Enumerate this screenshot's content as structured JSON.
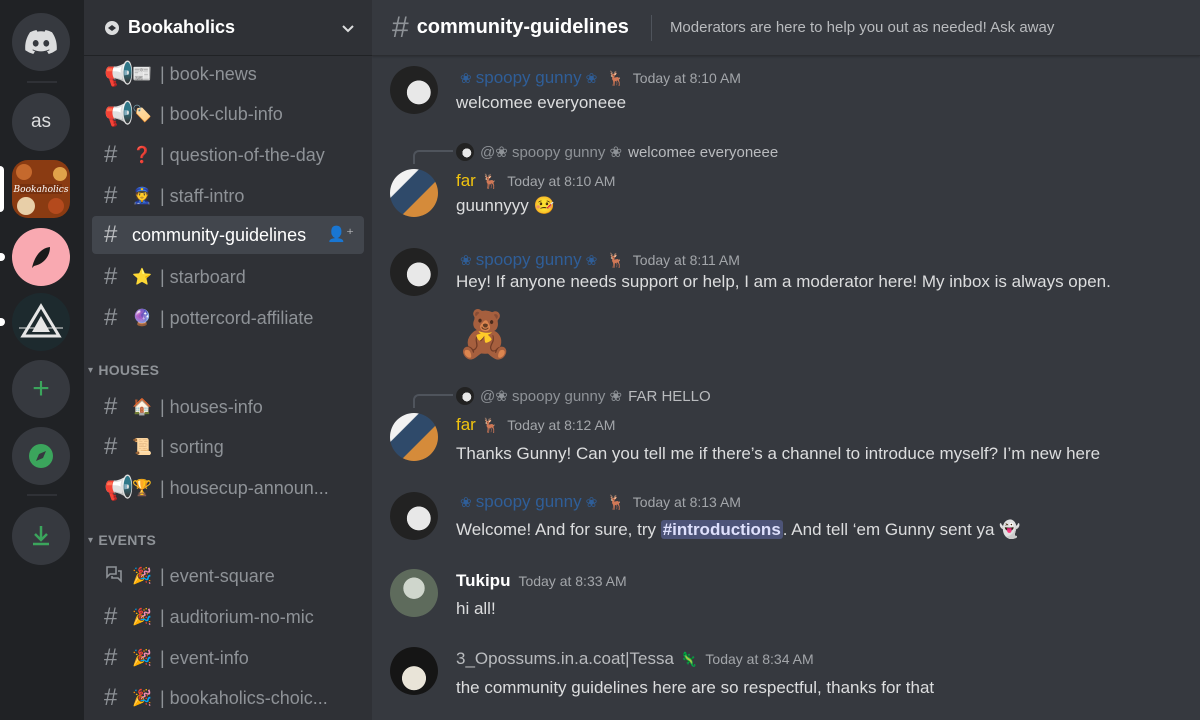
{
  "rail": {
    "home_icon": "discord-logo-icon",
    "servers": [
      {
        "label": "as"
      },
      {
        "label": "Bookaholics",
        "selected": true
      },
      {
        "label": ""
      },
      {
        "label": ""
      }
    ],
    "add_icon": "plus-icon",
    "explore_icon": "compass-icon",
    "download_icon": "download-icon",
    "add_glyph": "+",
    "accent_green": "#3ba55c"
  },
  "sidebar": {
    "guild_name": "Bookaholics",
    "channels_top": [
      {
        "icon": "megaphone-icon",
        "emoji": "📰",
        "name": "| book-news"
      },
      {
        "icon": "megaphone-icon",
        "emoji": "🏷️",
        "name": "| book-club-info"
      },
      {
        "icon": "hash-icon",
        "emoji": "❓",
        "name": "| question-of-the-day"
      },
      {
        "icon": "hash-icon",
        "emoji": "👮",
        "name": "| staff-intro"
      },
      {
        "icon": "hash-icon",
        "emoji": "",
        "name": "community-guidelines",
        "active": true
      },
      {
        "icon": "hash-icon",
        "emoji": "⭐",
        "name": "| starboard"
      },
      {
        "icon": "hash-icon",
        "emoji": "🔮",
        "name": "| pottercord-affiliate"
      }
    ],
    "categories": [
      {
        "name": "HOUSES",
        "channels": [
          {
            "icon": "hash-icon",
            "emoji": "🏠",
            "name": "| houses-info"
          },
          {
            "icon": "hash-icon",
            "emoji": "📜",
            "name": "| sorting"
          },
          {
            "icon": "megaphone-icon",
            "emoji": "🏆",
            "name": "| housecup-announ..."
          }
        ]
      },
      {
        "name": "EVENTS",
        "channels": [
          {
            "icon": "forum-icon",
            "emoji": "🎉",
            "name": "| event-square"
          },
          {
            "icon": "hash-icon",
            "emoji": "🎉",
            "name": "| auditorium-no-mic"
          },
          {
            "icon": "hash-icon",
            "emoji": "🎉",
            "name": "| event-info"
          },
          {
            "icon": "hash-icon",
            "emoji": "🎉",
            "name": "| bookaholics-choic..."
          }
        ]
      }
    ]
  },
  "chat": {
    "channel_name": "community-guidelines",
    "topic": "Moderators are here to help you out as needed! Ask away",
    "hash_glyph": "#",
    "messages": [
      {
        "author": "spoopy gunny",
        "timestamp": "Today at 8:10 AM",
        "text": "welcomee everyoneee"
      },
      {
        "reply_author": "@❀ spoopy gunny ❀",
        "reply_text": "welcomee everyoneee",
        "author": "far",
        "timestamp": "Today at 8:10 AM",
        "text": "guunnyyy 🤒"
      },
      {
        "author": "spoopy gunny",
        "timestamp": "Today at 8:11 AM",
        "text": "Hey! If anyone needs support or help, I am a moderator here! My inbox is always open.",
        "sticker": "🧸"
      },
      {
        "reply_author": "@❀ spoopy gunny ❀",
        "reply_text": "FAR HELLO",
        "author": "far",
        "timestamp": "Today at 8:12 AM",
        "text": "Thanks Gunny! Can you tell me if there’s a channel to introduce myself? I’m new here"
      },
      {
        "author": "spoopy gunny",
        "timestamp": "Today at 8:13 AM",
        "text_before": "Welcome! And for sure,  try ",
        "mention": "#introductions",
        "text_after": ". And tell ‘em Gunny sent ya 👻"
      },
      {
        "author": "Tukipu",
        "timestamp": "Today at 8:33 AM",
        "text": "hi all!"
      },
      {
        "author": "3_Opossums.in.a.coat|Tessa",
        "timestamp": "Today at 8:34 AM",
        "text": "the community guidelines here are so respectful, thanks for that"
      }
    ]
  }
}
